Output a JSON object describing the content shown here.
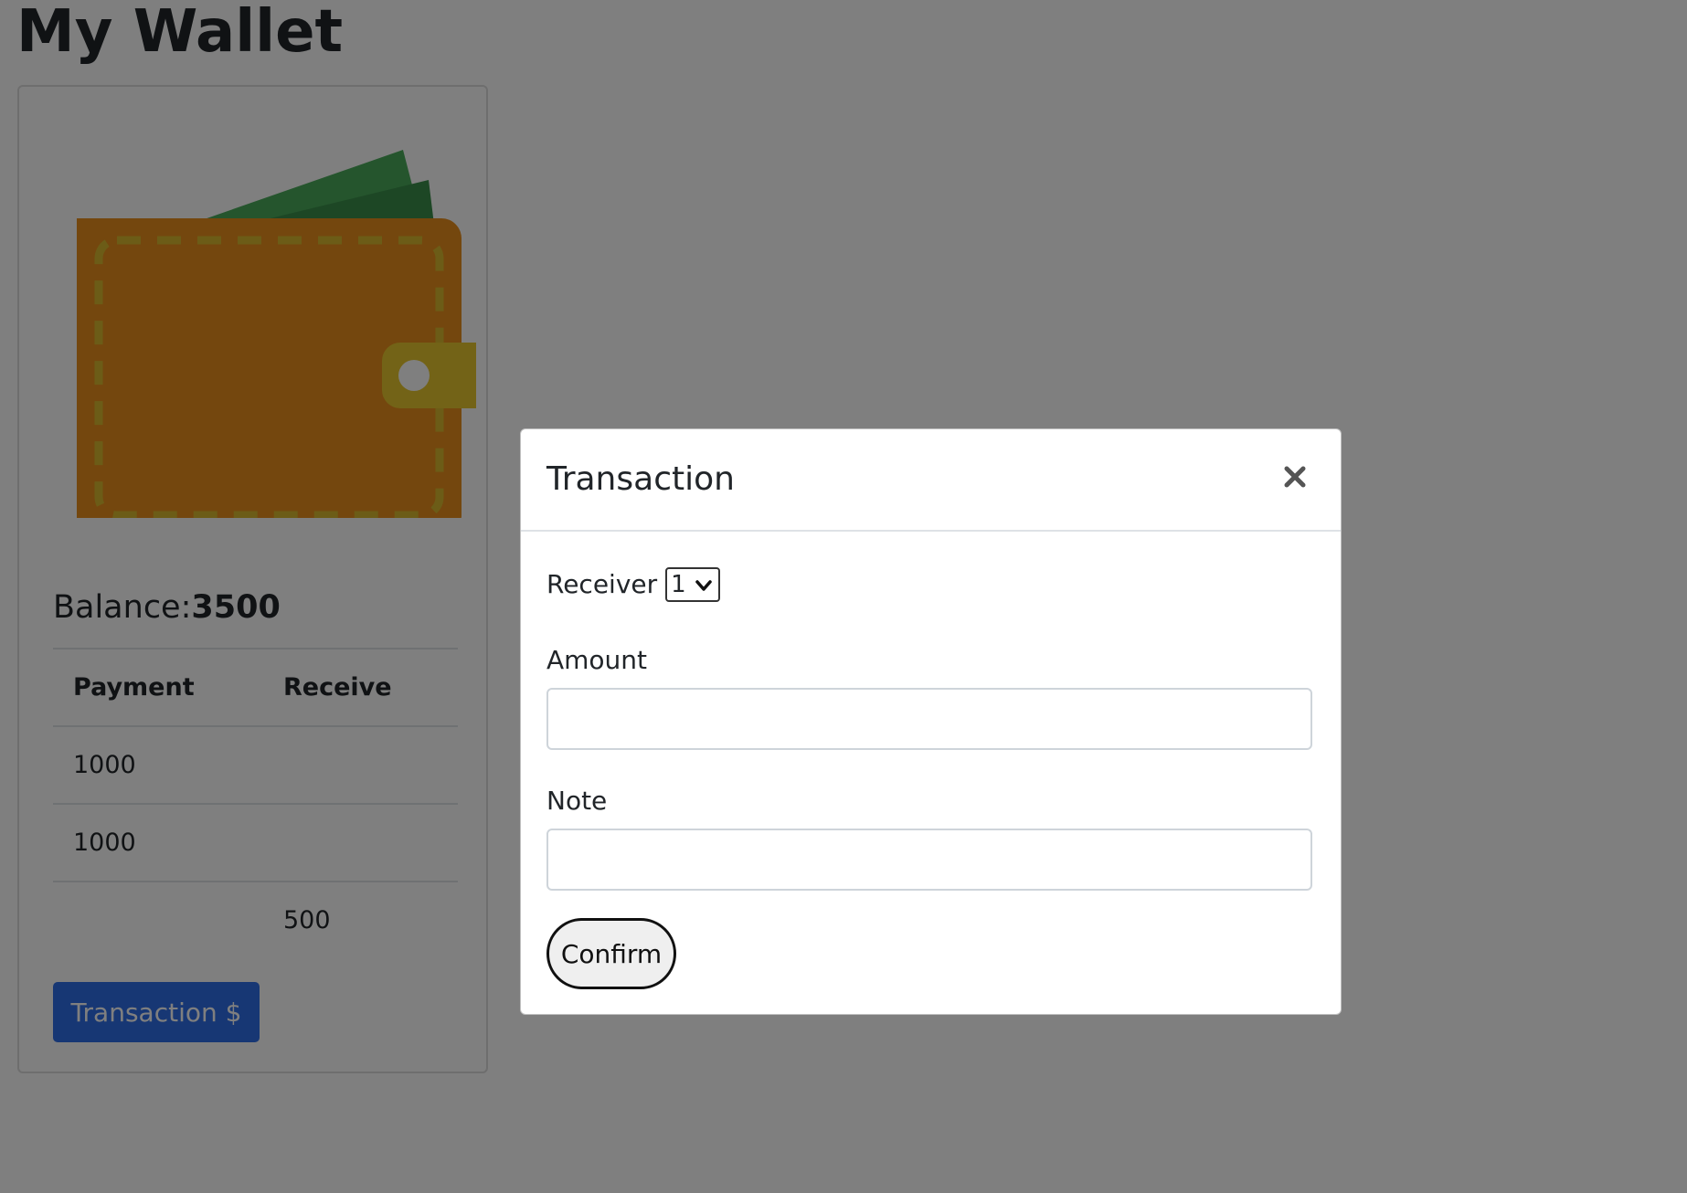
{
  "page": {
    "title": "My Wallet"
  },
  "wallet": {
    "illustration_icon": "wallet-icon",
    "balance_label": "Balance:",
    "balance_value": "3500",
    "table": {
      "headers": [
        "Payment",
        "Receive"
      ],
      "rows": [
        [
          "1000",
          ""
        ],
        [
          "1000",
          ""
        ],
        [
          "",
          "500"
        ]
      ]
    },
    "transaction_button_label": "Transaction $"
  },
  "modal": {
    "title": "Transaction",
    "close_icon": "close-icon",
    "receiver_label": "Receiver",
    "receiver_selected": "1",
    "amount_label": "Amount",
    "amount_value": "",
    "note_label": "Note",
    "note_value": "",
    "confirm_label": "Confirm"
  },
  "colors": {
    "primary_button": "#2f6fe8",
    "wallet_leather": "#e88f1c",
    "wallet_stitch": "#d9b92e",
    "bills_green": "#2e7d3c",
    "backdrop": "rgba(0,0,0,0.5)"
  }
}
